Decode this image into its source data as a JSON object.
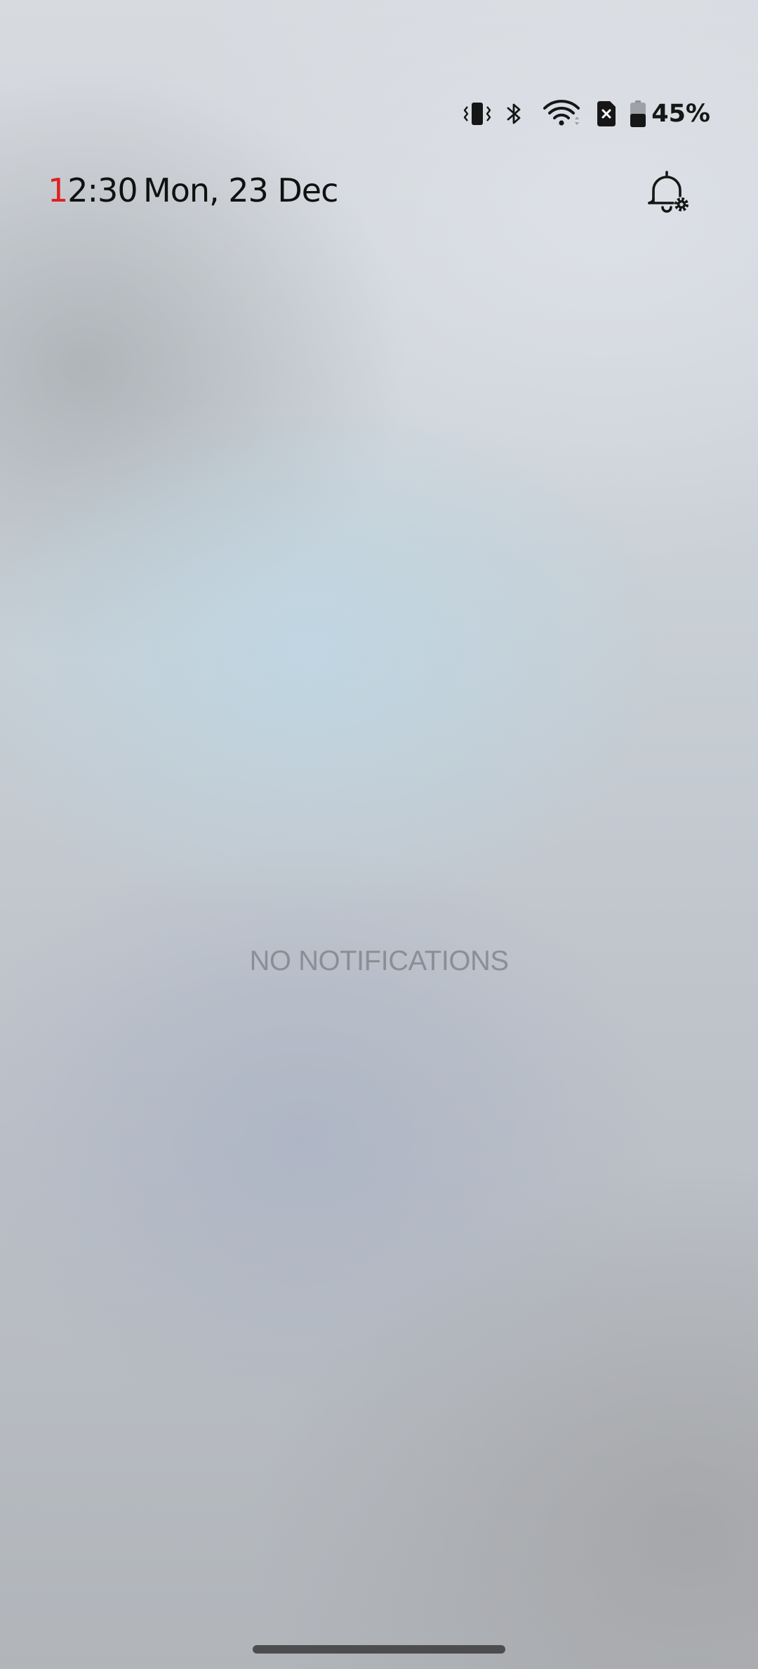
{
  "status_bar": {
    "icons": [
      "vibrate-icon",
      "bluetooth-icon",
      "wifi-icon",
      "no-sim-icon",
      "battery-icon"
    ],
    "battery_level": 45,
    "battery_text": "45%"
  },
  "header": {
    "time_first_digit": "1",
    "time_rest": "2:30",
    "date": "Mon, 23 Dec",
    "time_accent_color": "#e0201f"
  },
  "notifications": {
    "empty_label": "NO NOTIFICATIONS"
  }
}
